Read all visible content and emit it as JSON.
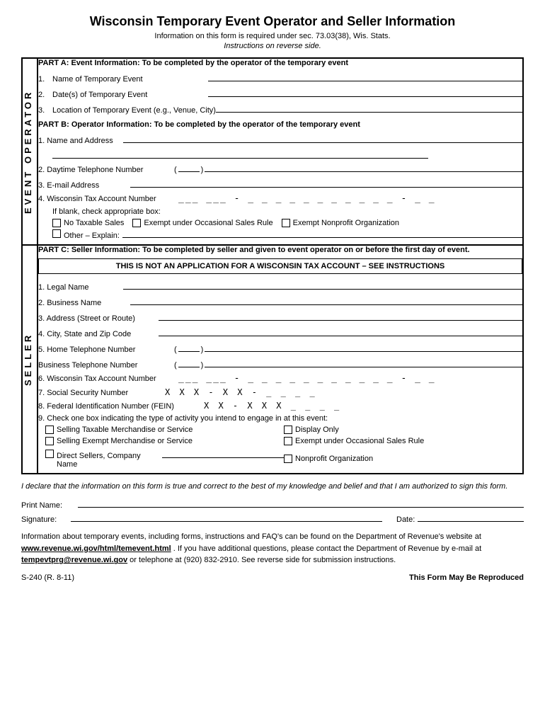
{
  "title": "Wisconsin Temporary Event Operator and Seller Information",
  "subtitle": "Information on this form is required under sec. 73.03(38), Wis. Stats.",
  "subtitle_italic": "Instructions on reverse side.",
  "event_section": {
    "side_label": "EVENT OPERATOR",
    "part_a_header": "PART A:   Event Information:  To be completed by the operator of the temporary event",
    "fields": [
      {
        "num": "1.",
        "label": "Name of Temporary Event"
      },
      {
        "num": "2.",
        "label": "Date(s) of Temporary Event"
      },
      {
        "num": "3.",
        "label": "Location of Temporary Event (e.g., Venue, City)"
      }
    ],
    "part_b_header": "PART B:   Operator Information:  To be completed by the operator of the temporary event",
    "name_address_label": "1.   Name and Address",
    "daytime_phone_label": "2.   Daytime Telephone Number",
    "email_label": "3.   E-mail Address",
    "wi_tax_label": "4.   Wisconsin Tax Account Number",
    "tax_dashes": "___ ___ - _ _ _ _ _ _ _ _ _ _ _ - _ _",
    "if_blank_label": "If blank, check appropriate box:",
    "checkboxes": [
      "No Taxable Sales",
      "Exempt under Occasional Sales Rule",
      "Exempt Nonprofit Organization",
      "Other – Explain:"
    ]
  },
  "seller_section": {
    "side_label": "SELLER",
    "part_c_header": "PART C:   Seller Information:  To be completed by seller and given to event operator on or before the first day of event.",
    "notice": "THIS IS NOT AN APPLICATION FOR A WISCONSIN TAX ACCOUNT – SEE INSTRUCTIONS",
    "fields": [
      {
        "num": "1.",
        "label": "Legal Name"
      },
      {
        "num": "2.",
        "label": "Business Name"
      },
      {
        "num": "3.",
        "label": "Address (Street or Route)"
      },
      {
        "num": "4.",
        "label": "City, State and Zip Code"
      }
    ],
    "home_phone_label": "5.   Home Telephone Number",
    "business_phone_label": "Business Telephone Number",
    "wi_tax_label": "6.   Wisconsin Tax Account Number",
    "wi_tax_dashes": "___ ___ - _ _ _ _ _ _ _ _ _ _ _ - _ _",
    "ssn_label": "7.   Social Security Number",
    "ssn_dashes": "X X X - X X - _ _ _ _",
    "fein_label": "8.   Federal Identification Number (FEIN)",
    "fein_dashes": "X X - X X X _ _ _ _",
    "activity_label": "9.   Check one box indicating the type of activity you intend to engage in at this event:",
    "activity_checkboxes_left": [
      "Selling Taxable Merchandise or Service",
      "Selling Exempt Merchandise or Service",
      "Direct Sellers, Company Name"
    ],
    "activity_checkboxes_right": [
      "Display Only",
      "Exempt under Occasional Sales Rule",
      "Nonprofit Organization"
    ]
  },
  "declaration": {
    "text": "I declare that the information on this form is true and correct to the best of my knowledge and belief and that I am authorized to sign this form.",
    "print_name_label": "Print Name:",
    "signature_label": "Signature:",
    "date_label": "Date:"
  },
  "footer": {
    "info_line1": "Information about temporary events, including forms, instructions and FAQ's can be found on the Department of Revenue's website at",
    "website": "www.revenue.wi.gov/html/temevent.html",
    "info_line2": ".  If you have additional questions, please contact the Department of Revenue by e-mail at",
    "email": "tempevtprg@revenue.wi.gov",
    "info_line3": " or telephone at (920) 832-2910.  See reverse side for submission instructions.",
    "form_number": "S-240 (R. 8-11)",
    "reproduce_label": "This Form May Be Reproduced"
  }
}
